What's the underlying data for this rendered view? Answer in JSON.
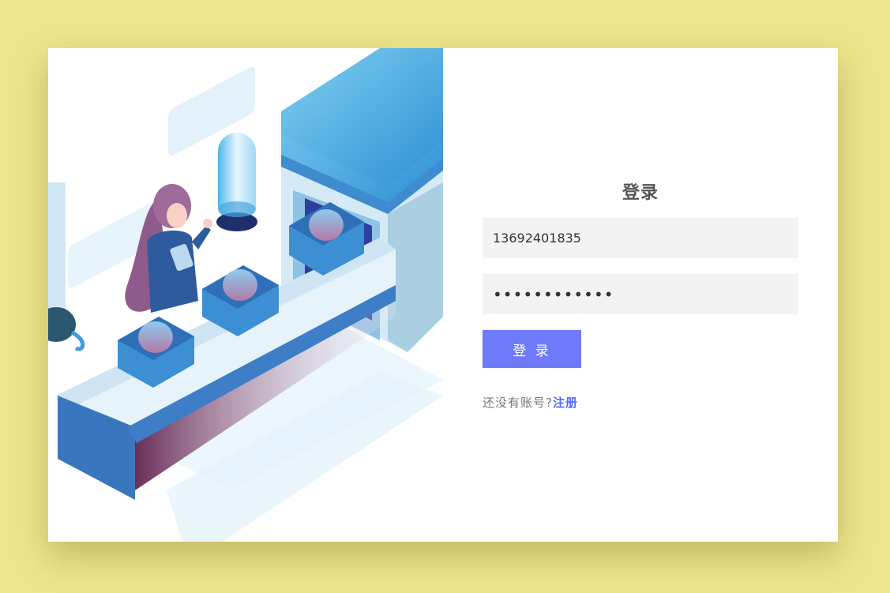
{
  "login": {
    "title": "登录",
    "phone_value": "13692401835",
    "password_value": "••••••••••••",
    "login_button_label": "登 录",
    "no_account_text": "还没有账号?",
    "register_link_label": "注册"
  },
  "colors": {
    "page_background": "#eee48c",
    "card_background": "#ffffff",
    "button_accent": "#6f7afa",
    "link_accent": "#4d6cf7",
    "input_background": "#f3f3f3"
  }
}
